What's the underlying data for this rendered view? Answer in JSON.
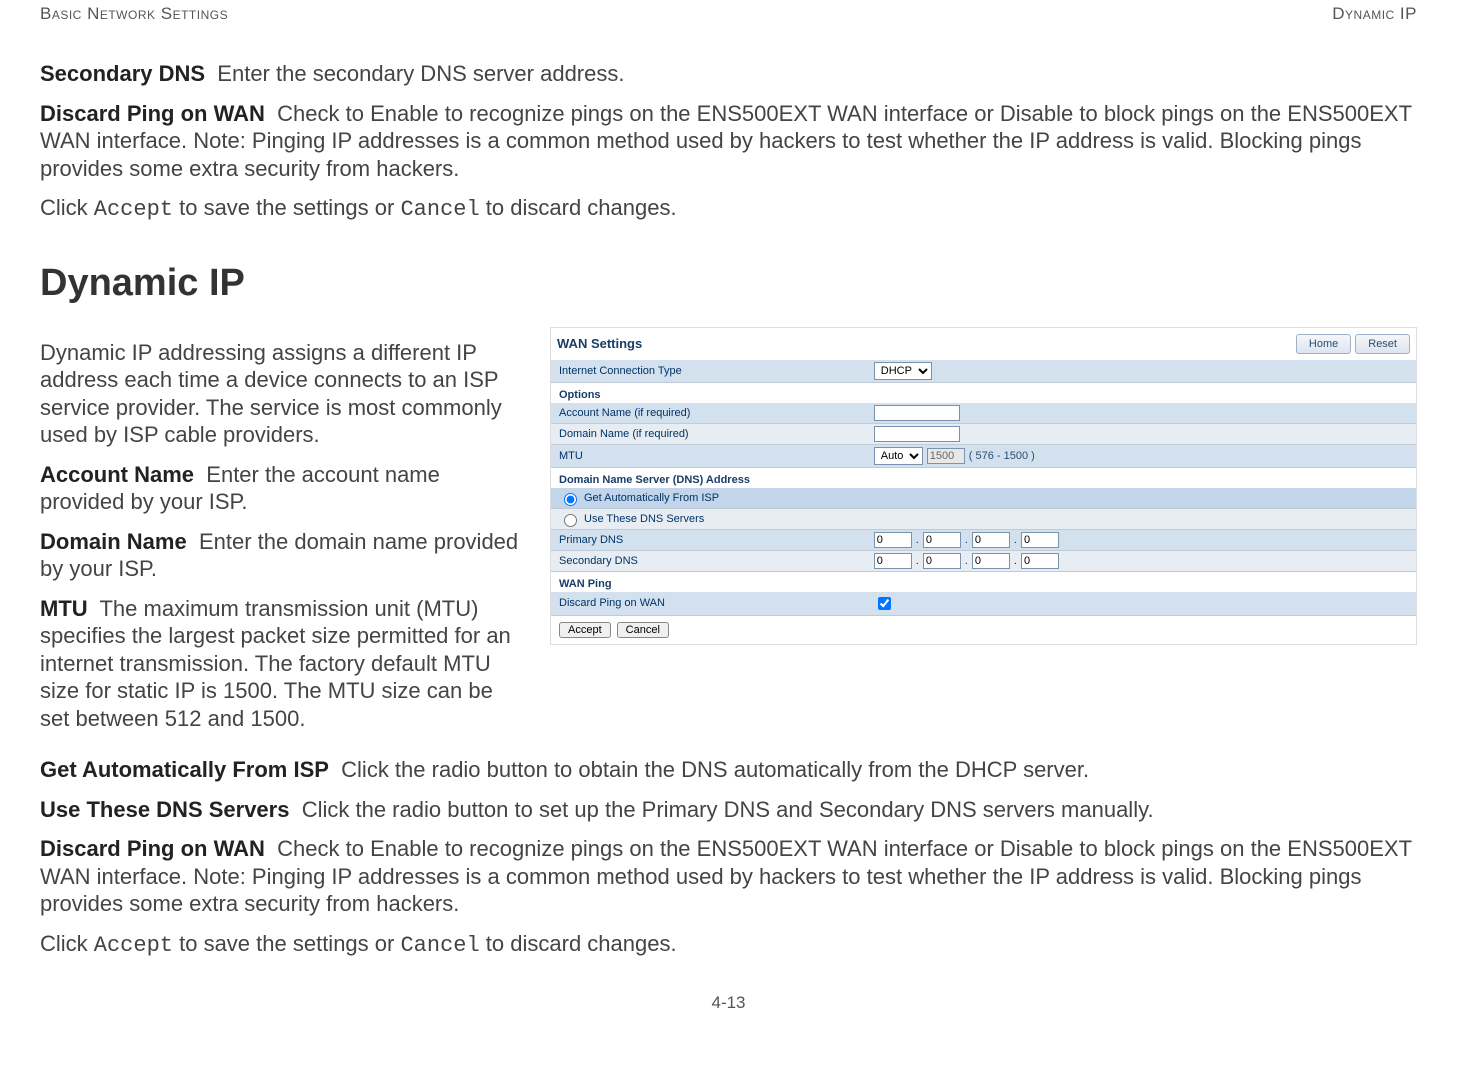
{
  "header": {
    "left": "Basic Network Settings",
    "right": "Dynamic IP"
  },
  "intro_terms": {
    "secondary_dns": {
      "term": "Secondary DNS",
      "desc": "Enter the secondary DNS server address."
    },
    "discard_ping_top": {
      "term": "Discard Ping on WAN",
      "desc": "Check to Enable to recognize pings on the ENS500EXT WAN interface or Disable to block pings on the ENS500EXT WAN interface. Note: Pinging IP addresses is a common method used by hackers to test whether the IP address is valid. Blocking pings provides some extra security from hackers."
    },
    "click_accept_top": {
      "pre": "Click ",
      "accept": "Accept",
      "mid": " to save the settings or ",
      "cancel": "Cancel",
      "post": " to discard changes."
    }
  },
  "section_title": "Dynamic IP",
  "dynamic_ip_intro": "Dynamic IP addressing assigns a different IP address each time a device connects to an ISP service provider. The service is most commonly used by ISP cable providers.",
  "fields": {
    "account_name": {
      "term": "Account Name",
      "desc": "Enter the account name provided by your ISP."
    },
    "domain_name": {
      "term": "Domain Name",
      "desc": "Enter the domain name provided by your ISP."
    },
    "mtu": {
      "term": "MTU",
      "desc": "The maximum transmission unit (MTU) specifies the largest packet size permitted for an internet transmission. The factory default MTU size for static IP is 1500. The MTU size can be set between 512 and 1500."
    },
    "get_auto": {
      "term": "Get Automatically From ISP",
      "desc": "Click the radio button to obtain the DNS automatically from the DHCP server."
    },
    "use_these": {
      "term": "Use These DNS Servers",
      "desc": "Click the radio button to set up the Primary DNS and Secondary DNS servers manually."
    },
    "discard_ping_bottom": {
      "term": "Discard Ping on WAN",
      "desc": "Check to Enable to recognize pings on the ENS500EXT WAN interface or Disable to block pings on the ENS500EXT WAN interface. Note: Pinging IP addresses is a common method used by hackers to test whether the IP address is valid. Blocking pings provides some extra security from hackers."
    },
    "click_accept_bottom": {
      "pre": "Click ",
      "accept": "Accept",
      "mid": " to save the settings or ",
      "cancel": "Cancel",
      "post": " to discard changes."
    }
  },
  "screenshot": {
    "title": "WAN Settings",
    "btn_home": "Home",
    "btn_reset": "Reset",
    "rows": {
      "internet_type": {
        "label": "Internet Connection Type",
        "value": "DHCP"
      },
      "options_header": "Options",
      "account_name": {
        "label": "Account Name (if required)"
      },
      "domain_name": {
        "label": "Domain Name (if required)"
      },
      "mtu": {
        "label": "MTU",
        "mode": "Auto",
        "value": "1500",
        "hint": "( 576 - 1500 )"
      },
      "dns_header": "Domain Name Server (DNS) Address",
      "dns_auto": "Get Automatically From ISP",
      "dns_manual": "Use These DNS Servers",
      "primary_dns": {
        "label": "Primary DNS",
        "a": "0",
        "b": "0",
        "c": "0",
        "d": "0"
      },
      "secondary_dns": {
        "label": "Secondary DNS",
        "a": "0",
        "b": "0",
        "c": "0",
        "d": "0"
      },
      "wan_ping_header": "WAN Ping",
      "discard_ping": {
        "label": "Discard Ping on WAN",
        "checked": true
      }
    },
    "accept": "Accept",
    "cancel": "Cancel"
  },
  "page_number": "4-13"
}
